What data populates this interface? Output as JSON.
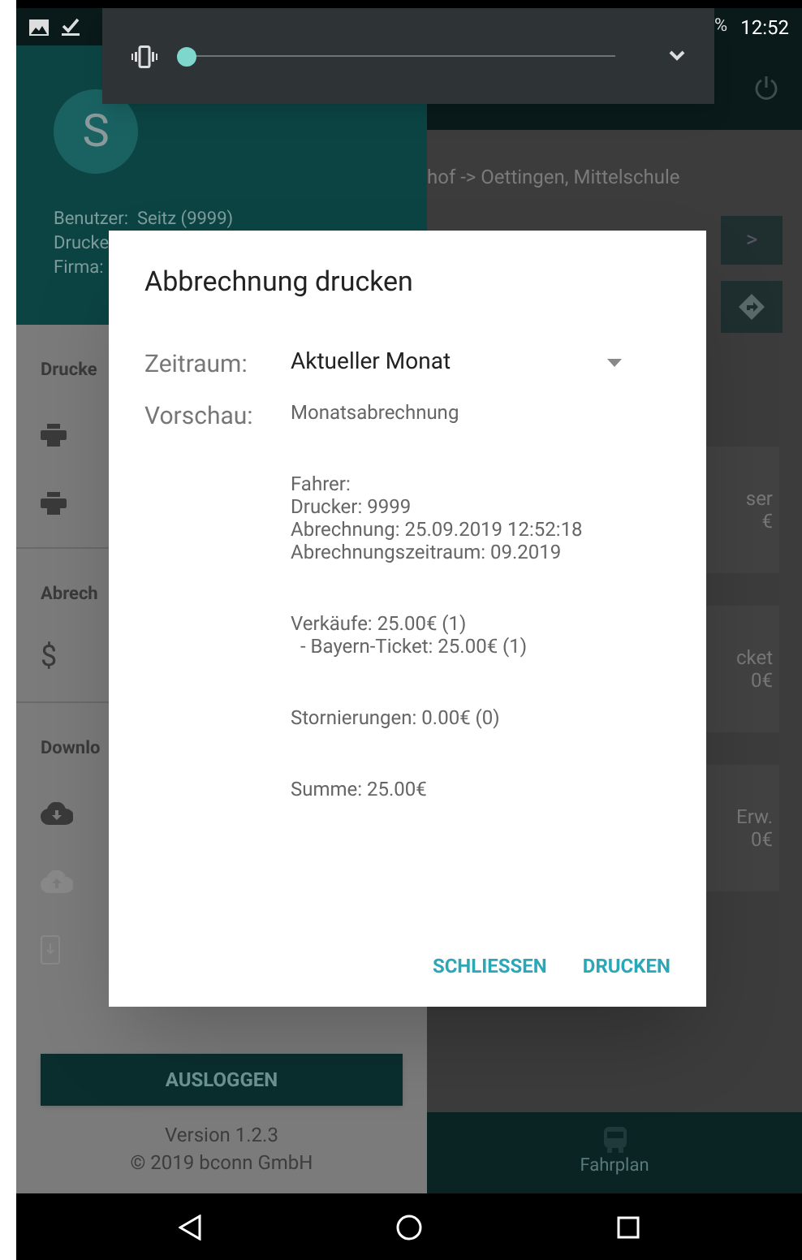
{
  "status_bar": {
    "battery": "%",
    "time": "12:52"
  },
  "volume_panel": {
    "level": 0
  },
  "drawer": {
    "avatar_letter": "S",
    "info": [
      "Benutzer:  Seitz (9999)",
      "Drucke",
      "Firma:"
    ],
    "sections": [
      {
        "title": "Drucke",
        "items": [
          {
            "kind": "printer"
          },
          {
            "kind": "printer"
          }
        ]
      },
      {
        "title": "Abrech",
        "items": [
          {
            "kind": "dollar",
            "glyph": "$"
          }
        ]
      },
      {
        "title": "Downlo",
        "items": [
          {
            "kind": "download",
            "disabled": false
          },
          {
            "kind": "upload",
            "disabled": true
          },
          {
            "kind": "phone",
            "disabled": true
          }
        ]
      }
    ],
    "logout": "AUSLOGGEN",
    "version": "Version 1.2.3",
    "copyright": "© 2019 bconn GmbH"
  },
  "main": {
    "route": "hof -> Oettingen, Mittelschule",
    "next": ">",
    "cards": [
      [
        "ser",
        "€"
      ],
      [
        "cket",
        "0€"
      ],
      [
        "Erw.",
        "0€"
      ]
    ],
    "bottom_nav": "Fahrplan"
  },
  "dialog": {
    "title": "Abbrechnung drucken",
    "period_label": "Zeitraum:",
    "period_value": "Aktueller Monat",
    "preview_label": "Vorschau:",
    "preview": [
      [
        {
          "text": "Monatsabrechnung",
          "indented": false
        }
      ],
      [
        {
          "text": "Fahrer:",
          "indented": false
        },
        {
          "text": "Drucker: 9999",
          "indented": false
        },
        {
          "text": "Abrechnung: 25.09.2019 12:52:18",
          "indented": false
        },
        {
          "text": "Abrechnungszeitraum: 09.2019",
          "indented": false
        }
      ],
      [
        {
          "text": "Verkäufe: 25.00€ (1)",
          "indented": false
        },
        {
          "text": "- Bayern-Ticket: 25.00€ (1)",
          "indented": true
        }
      ],
      [
        {
          "text": "Stornierungen: 0.00€ (0)",
          "indented": false
        }
      ],
      [
        {
          "text": "Summe: 25.00€",
          "indented": false
        }
      ]
    ],
    "buttons": [
      "SCHLIESSEN",
      "DRUCKEN"
    ]
  }
}
